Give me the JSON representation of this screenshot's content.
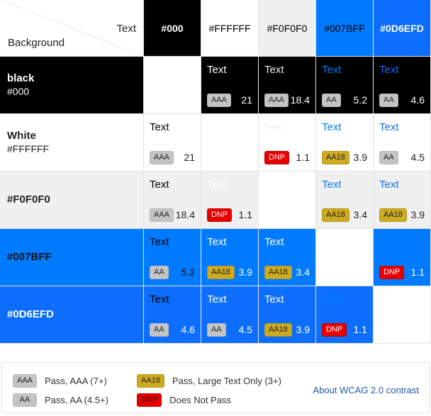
{
  "corner": {
    "text_label": "Text",
    "background_label": "Background"
  },
  "columns": [
    {
      "label": "#000",
      "bg": "#000000",
      "fg": "#ffffff",
      "fontWeight": "bold"
    },
    {
      "label": "#FFFFFF",
      "bg": "#ffffff",
      "fg": "#000000",
      "fontWeight": "normal"
    },
    {
      "label": "#F0F0F0",
      "bg": "#f0f0f0",
      "fg": "#000000",
      "fontWeight": "normal"
    },
    {
      "label": "#007BFF",
      "bg": "#007bff",
      "fg": "#000000",
      "fontWeight": "normal"
    },
    {
      "label": "#0D6EFD",
      "bg": "#0d6efd",
      "fg": "#ffffff",
      "fontWeight": "bold"
    }
  ],
  "colors": {
    "black": "#000000",
    "white": "#ffffff",
    "f0": "#f0f0f0",
    "blue1": "#007bff",
    "blue2": "#0d6efd",
    "aa18": "#ccaa22",
    "dnp": "#e60000",
    "aa": "#c4c4c4",
    "link": "#2057a5"
  },
  "rows": [
    {
      "name": "black",
      "hex": "#000",
      "bg": "#000000",
      "head_fg": "#ffffff",
      "cells": [
        null,
        {
          "text": "Text",
          "text_color": "#ffffff",
          "badge": "AAA",
          "ratio": "21",
          "ratio_color": "#ffffff"
        },
        {
          "text": "Text",
          "text_color": "#f0f0f0",
          "badge": "AAA",
          "ratio": "18.4",
          "ratio_color": "#ffffff"
        },
        {
          "text": "Text",
          "text_color": "#007bff",
          "badge": "AA",
          "ratio": "5.2",
          "ratio_color": "#ffffff"
        },
        {
          "text": "Text",
          "text_color": "#0d6efd",
          "badge": "AA",
          "ratio": "4.6",
          "ratio_color": "#ffffff"
        }
      ]
    },
    {
      "name": "White",
      "hex": "#FFFFFF",
      "bg": "#ffffff",
      "head_fg": "#222222",
      "cells": [
        {
          "text": "Text",
          "text_color": "#000000",
          "badge": "AAA",
          "ratio": "21",
          "ratio_color": "#222222"
        },
        null,
        {
          "text": "Text",
          "text_color": "#f0f0f0",
          "badge": "DNP",
          "ratio": "1.1",
          "ratio_color": "#222222"
        },
        {
          "text": "Text",
          "text_color": "#007bff",
          "badge": "AA18",
          "ratio": "3.9",
          "ratio_color": "#222222"
        },
        {
          "text": "Text",
          "text_color": "#0d6efd",
          "badge": "AA",
          "ratio": "4.5",
          "ratio_color": "#222222"
        }
      ]
    },
    {
      "name": "",
      "hex": "#F0F0F0",
      "bg": "#f0f0f0",
      "head_fg": "#222222",
      "hex_bold": true,
      "cells": [
        {
          "text": "Text",
          "text_color": "#000000",
          "badge": "AAA",
          "ratio": "18.4",
          "ratio_color": "#222222"
        },
        {
          "text": "Text",
          "text_color": "#ffffff",
          "badge": "DNP",
          "ratio": "1.1",
          "ratio_color": "#222222"
        },
        null,
        {
          "text": "Text",
          "text_color": "#007bff",
          "badge": "AA18",
          "ratio": "3.4",
          "ratio_color": "#222222"
        },
        {
          "text": "Text",
          "text_color": "#0d6efd",
          "badge": "AA18",
          "ratio": "3.9",
          "ratio_color": "#222222"
        }
      ]
    },
    {
      "name": "",
      "hex": "#007BFF",
      "bg": "#007bff",
      "head_fg": "#111111",
      "hex_bold": true,
      "cells": [
        {
          "text": "Text",
          "text_color": "#000000",
          "badge": "AA",
          "ratio": "5.2",
          "ratio_color": "#111111"
        },
        {
          "text": "Text",
          "text_color": "#ffffff",
          "badge": "AA18",
          "ratio": "3.9",
          "ratio_color": "#ffffff"
        },
        {
          "text": "Text",
          "text_color": "#ffffff",
          "badge": "AA18",
          "ratio": "3.4",
          "ratio_color": "#ffffff"
        },
        null,
        {
          "text": "Text",
          "text_color": "#0d6efd",
          "badge": "DNP",
          "ratio": "1.1",
          "ratio_color": "#ffffff"
        }
      ]
    },
    {
      "name": "",
      "hex": "#0D6EFD",
      "bg": "#0d6efd",
      "head_fg": "#ffffff",
      "hex_bold": true,
      "cells": [
        {
          "text": "Text",
          "text_color": "#000000",
          "badge": "AA",
          "ratio": "4.6",
          "ratio_color": "#ffffff"
        },
        {
          "text": "Text",
          "text_color": "#ffffff",
          "badge": "AA",
          "ratio": "4.5",
          "ratio_color": "#ffffff"
        },
        {
          "text": "Text",
          "text_color": "#ffffff",
          "badge": "AA18",
          "ratio": "3.9",
          "ratio_color": "#ffffff"
        },
        {
          "text": "Text",
          "text_color": "#007bff",
          "badge": "DNP",
          "ratio": "1.1",
          "ratio_color": "#ffffff"
        },
        null
      ]
    }
  ],
  "legend": {
    "items": [
      {
        "badge": "AAA",
        "desc": "Pass, AAA (7+)"
      },
      {
        "badge": "AA",
        "desc": "Pass, AA (4.5+)"
      },
      {
        "badge": "AA18",
        "desc": "Pass, Large Text Only (3+)"
      },
      {
        "badge": "DNP",
        "desc": "Does Not Pass"
      }
    ],
    "link": "About WCAG 2.0 contrast"
  }
}
